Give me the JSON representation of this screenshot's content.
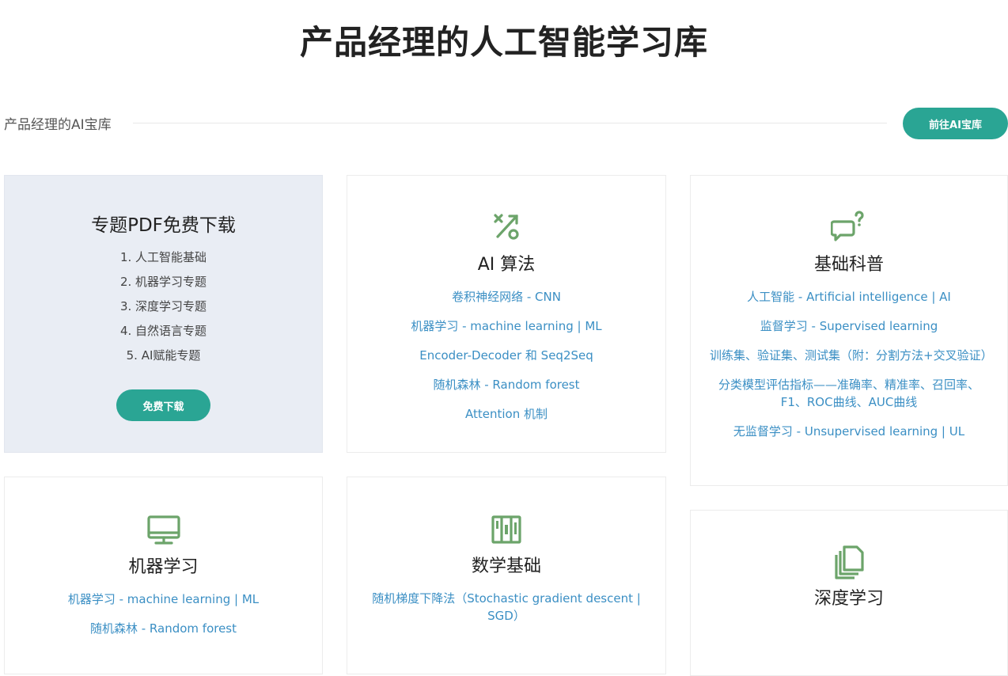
{
  "page": {
    "title": "产品经理的人工智能学习库"
  },
  "section": {
    "label": "产品经理的AI宝库",
    "button_label": "前往AI宝库"
  },
  "pdf_card": {
    "title": "专题PDF免费下载",
    "items": [
      "1. 人工智能基础",
      "2. 机器学习专题",
      "3. 深度学习专题",
      "4. 自然语言专题",
      "5. AI赋能专题"
    ],
    "button_label": "免费下载"
  },
  "cards": [
    {
      "id": "ai-algorithm",
      "title": "AI 算法",
      "icon": "percent-icon",
      "links": [
        "卷积神经网络 - CNN",
        "机器学习 - machine learning | ML",
        "Encoder-Decoder 和 Seq2Seq",
        "随机森林 - Random forest",
        "Attention 机制"
      ]
    },
    {
      "id": "basic-science",
      "title": "基础科普",
      "icon": "chat-question-icon",
      "links": [
        "人工智能 - Artificial intelligence | AI",
        "监督学习 - Supervised learning",
        "训练集、验证集、测试集（附：分割方法+交叉验证）",
        "分类模型评估指标——准确率、精准率、召回率、F1、ROC曲线、AUC曲线",
        "无监督学习 - Unsupervised learning | UL"
      ]
    },
    {
      "id": "machine-learning",
      "title": "机器学习",
      "icon": "monitor-icon",
      "links": [
        "机器学习 - machine learning | ML",
        "随机森林 - Random forest"
      ]
    },
    {
      "id": "math-basics",
      "title": "数学基础",
      "icon": "columns-icon",
      "links": [
        "随机梯度下降法（Stochastic gradient descent | SGD）"
      ]
    },
    {
      "id": "deep-learning",
      "title": "深度学习",
      "icon": "files-icon",
      "links": []
    }
  ],
  "colors": {
    "accent": "#2aa594",
    "link": "#3b8fc4",
    "icon": "#6ca46a",
    "pdf_card_bg": "#e9edf4"
  }
}
